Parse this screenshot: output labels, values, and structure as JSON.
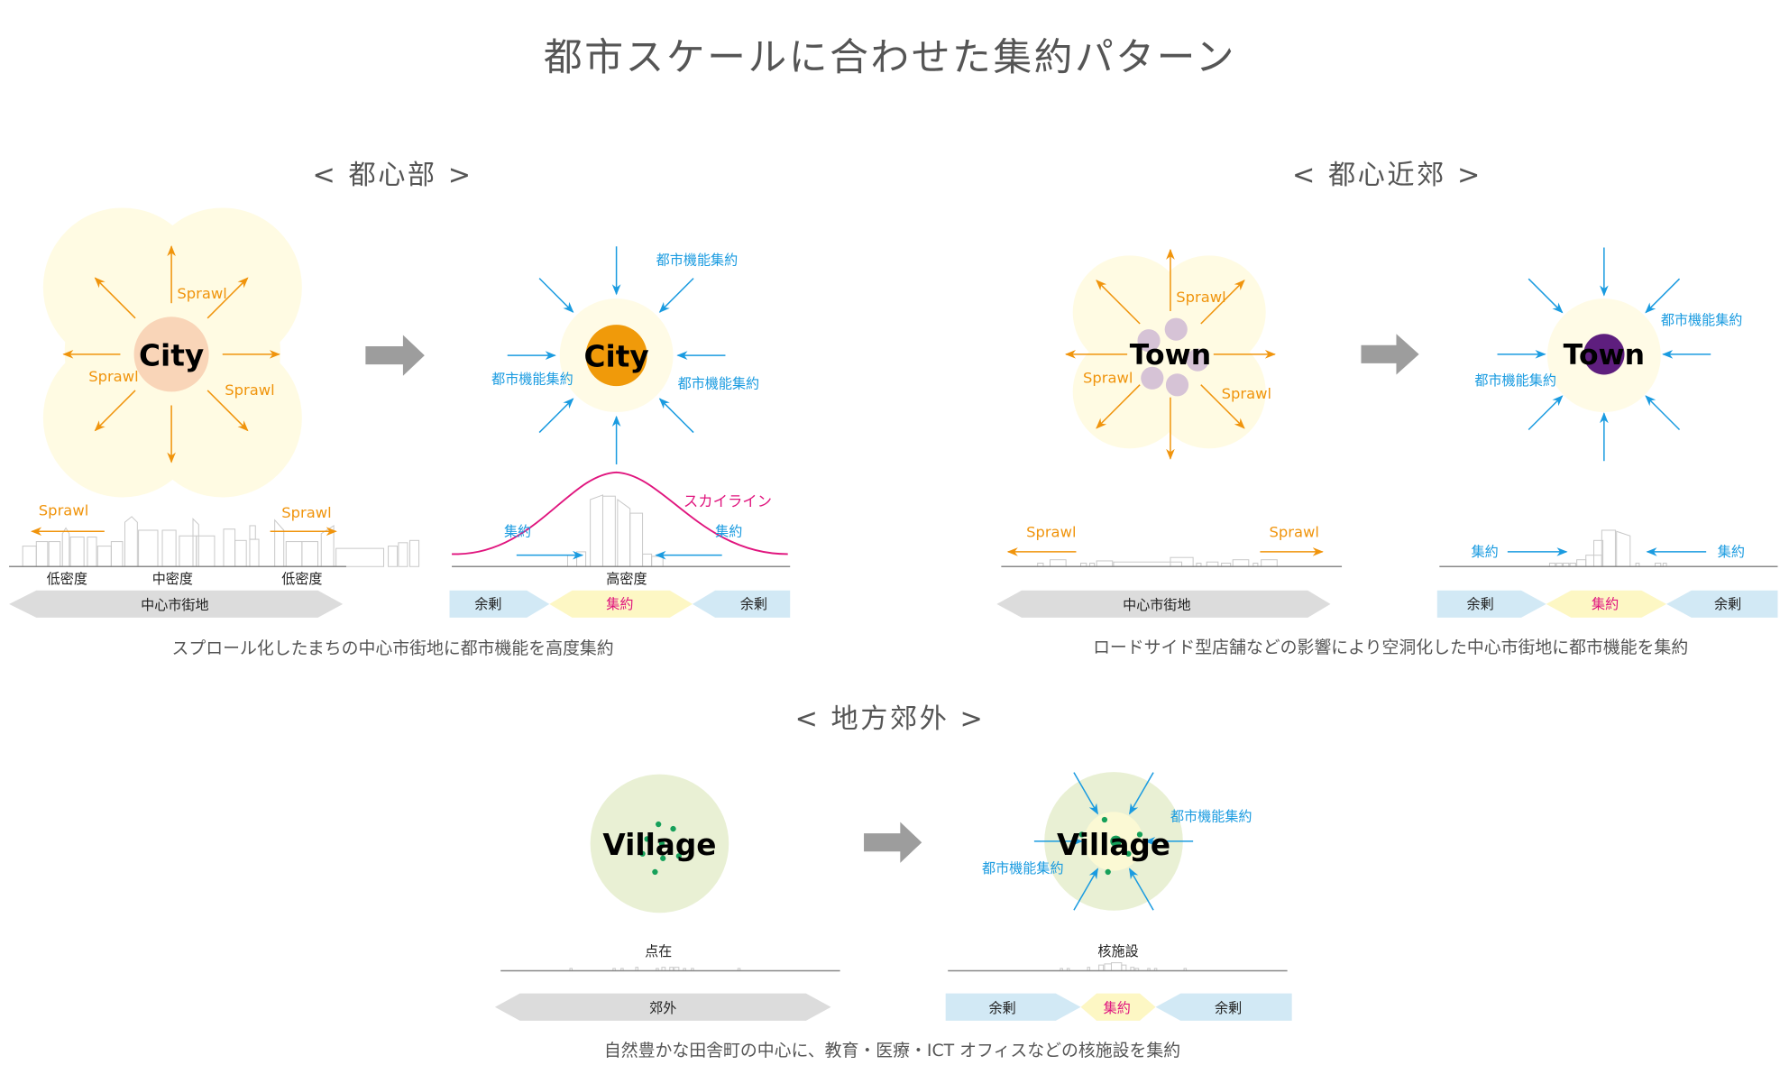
{
  "title": "都市スケールに合わせた集約パターン",
  "colors": {
    "sprawl": "#f0940c",
    "concentrate": "#1a9be0",
    "skyline": "#e0157e",
    "glow": "#fffbe6",
    "city_before": "#f9d5b8",
    "city_after": "#f09a0a",
    "town_dots": "#d6c3d6",
    "town_after": "#5e1e7e",
    "village_bg": "#e9f0d4",
    "village_dot": "#16a05a",
    "band_surplus": "#d2e9f5",
    "band_concentrate": "#fdf7c4",
    "band_gray": "#dcdcdc",
    "arrow_gray": "#9d9d9d"
  },
  "sections": {
    "urban": {
      "heading": "< 都心部 >",
      "before": {
        "center": "City",
        "sprawl_labels": [
          "Sprawl",
          "Sprawl",
          "Sprawl"
        ],
        "profile_sprawl_left": "Sprawl",
        "profile_sprawl_right": "Sprawl",
        "density_labels": [
          "低密度",
          "中密度",
          "低密度"
        ],
        "band": "中心市街地"
      },
      "after": {
        "center": "City",
        "concentrate_labels": [
          "都市機能集約",
          "都市機能集約",
          "都市機能集約"
        ],
        "skyline_label": "スカイライン",
        "profile_arrows": [
          "集約",
          "集約"
        ],
        "density_label": "高密度",
        "bands": [
          "余剰",
          "集約",
          "余剰"
        ]
      },
      "caption": "スプロール化したまちの中心市街地に都市機能を高度集約"
    },
    "suburban": {
      "heading": "< 都心近郊 >",
      "before": {
        "center": "Town",
        "sprawl_labels": [
          "Sprawl",
          "Sprawl",
          "Sprawl"
        ],
        "profile_sprawl_left": "Sprawl",
        "profile_sprawl_right": "Sprawl",
        "band": "中心市街地"
      },
      "after": {
        "center": "Town",
        "concentrate_labels": [
          "都市機能集約",
          "都市機能集約"
        ],
        "profile_arrows": [
          "集約",
          "集約"
        ],
        "bands": [
          "余剰",
          "集約",
          "余剰"
        ]
      },
      "caption": "ロードサイド型店舗などの影響により空洞化した中心市街地に都市機能を集約"
    },
    "rural": {
      "heading": "< 地方郊外 >",
      "before": {
        "center": "Village",
        "profile_label": "点在",
        "band": "郊外"
      },
      "after": {
        "center": "Village",
        "concentrate_labels": [
          "都市機能集約",
          "都市機能集約"
        ],
        "profile_label": "核施設",
        "bands": [
          "余剰",
          "集約",
          "余剰"
        ]
      },
      "caption": "自然豊かな田舎町の中心に、教育・医療・ICT オフィスなどの核施設を集約"
    }
  }
}
